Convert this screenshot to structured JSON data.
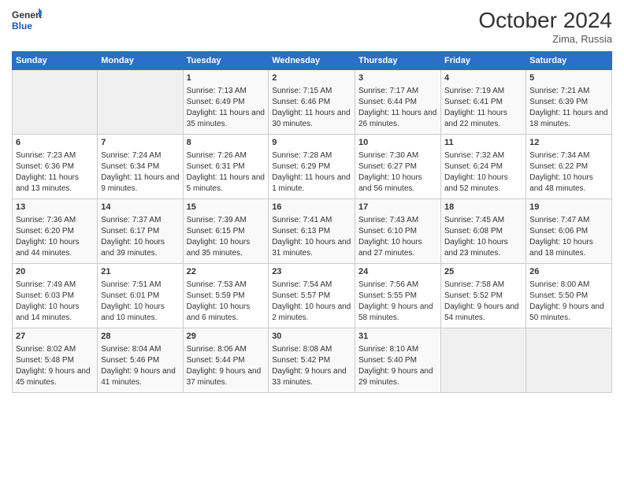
{
  "header": {
    "logo_line1": "General",
    "logo_line2": "Blue",
    "month": "October 2024",
    "location": "Zima, Russia"
  },
  "days_of_week": [
    "Sunday",
    "Monday",
    "Tuesday",
    "Wednesday",
    "Thursday",
    "Friday",
    "Saturday"
  ],
  "weeks": [
    [
      {
        "day": "",
        "sunrise": "",
        "sunset": "",
        "daylight": ""
      },
      {
        "day": "",
        "sunrise": "",
        "sunset": "",
        "daylight": ""
      },
      {
        "day": "1",
        "sunrise": "Sunrise: 7:13 AM",
        "sunset": "Sunset: 6:49 PM",
        "daylight": "Daylight: 11 hours and 35 minutes."
      },
      {
        "day": "2",
        "sunrise": "Sunrise: 7:15 AM",
        "sunset": "Sunset: 6:46 PM",
        "daylight": "Daylight: 11 hours and 30 minutes."
      },
      {
        "day": "3",
        "sunrise": "Sunrise: 7:17 AM",
        "sunset": "Sunset: 6:44 PM",
        "daylight": "Daylight: 11 hours and 26 minutes."
      },
      {
        "day": "4",
        "sunrise": "Sunrise: 7:19 AM",
        "sunset": "Sunset: 6:41 PM",
        "daylight": "Daylight: 11 hours and 22 minutes."
      },
      {
        "day": "5",
        "sunrise": "Sunrise: 7:21 AM",
        "sunset": "Sunset: 6:39 PM",
        "daylight": "Daylight: 11 hours and 18 minutes."
      }
    ],
    [
      {
        "day": "6",
        "sunrise": "Sunrise: 7:23 AM",
        "sunset": "Sunset: 6:36 PM",
        "daylight": "Daylight: 11 hours and 13 minutes."
      },
      {
        "day": "7",
        "sunrise": "Sunrise: 7:24 AM",
        "sunset": "Sunset: 6:34 PM",
        "daylight": "Daylight: 11 hours and 9 minutes."
      },
      {
        "day": "8",
        "sunrise": "Sunrise: 7:26 AM",
        "sunset": "Sunset: 6:31 PM",
        "daylight": "Daylight: 11 hours and 5 minutes."
      },
      {
        "day": "9",
        "sunrise": "Sunrise: 7:28 AM",
        "sunset": "Sunset: 6:29 PM",
        "daylight": "Daylight: 11 hours and 1 minute."
      },
      {
        "day": "10",
        "sunrise": "Sunrise: 7:30 AM",
        "sunset": "Sunset: 6:27 PM",
        "daylight": "Daylight: 10 hours and 56 minutes."
      },
      {
        "day": "11",
        "sunrise": "Sunrise: 7:32 AM",
        "sunset": "Sunset: 6:24 PM",
        "daylight": "Daylight: 10 hours and 52 minutes."
      },
      {
        "day": "12",
        "sunrise": "Sunrise: 7:34 AM",
        "sunset": "Sunset: 6:22 PM",
        "daylight": "Daylight: 10 hours and 48 minutes."
      }
    ],
    [
      {
        "day": "13",
        "sunrise": "Sunrise: 7:36 AM",
        "sunset": "Sunset: 6:20 PM",
        "daylight": "Daylight: 10 hours and 44 minutes."
      },
      {
        "day": "14",
        "sunrise": "Sunrise: 7:37 AM",
        "sunset": "Sunset: 6:17 PM",
        "daylight": "Daylight: 10 hours and 39 minutes."
      },
      {
        "day": "15",
        "sunrise": "Sunrise: 7:39 AM",
        "sunset": "Sunset: 6:15 PM",
        "daylight": "Daylight: 10 hours and 35 minutes."
      },
      {
        "day": "16",
        "sunrise": "Sunrise: 7:41 AM",
        "sunset": "Sunset: 6:13 PM",
        "daylight": "Daylight: 10 hours and 31 minutes."
      },
      {
        "day": "17",
        "sunrise": "Sunrise: 7:43 AM",
        "sunset": "Sunset: 6:10 PM",
        "daylight": "Daylight: 10 hours and 27 minutes."
      },
      {
        "day": "18",
        "sunrise": "Sunrise: 7:45 AM",
        "sunset": "Sunset: 6:08 PM",
        "daylight": "Daylight: 10 hours and 23 minutes."
      },
      {
        "day": "19",
        "sunrise": "Sunrise: 7:47 AM",
        "sunset": "Sunset: 6:06 PM",
        "daylight": "Daylight: 10 hours and 18 minutes."
      }
    ],
    [
      {
        "day": "20",
        "sunrise": "Sunrise: 7:49 AM",
        "sunset": "Sunset: 6:03 PM",
        "daylight": "Daylight: 10 hours and 14 minutes."
      },
      {
        "day": "21",
        "sunrise": "Sunrise: 7:51 AM",
        "sunset": "Sunset: 6:01 PM",
        "daylight": "Daylight: 10 hours and 10 minutes."
      },
      {
        "day": "22",
        "sunrise": "Sunrise: 7:53 AM",
        "sunset": "Sunset: 5:59 PM",
        "daylight": "Daylight: 10 hours and 6 minutes."
      },
      {
        "day": "23",
        "sunrise": "Sunrise: 7:54 AM",
        "sunset": "Sunset: 5:57 PM",
        "daylight": "Daylight: 10 hours and 2 minutes."
      },
      {
        "day": "24",
        "sunrise": "Sunrise: 7:56 AM",
        "sunset": "Sunset: 5:55 PM",
        "daylight": "Daylight: 9 hours and 58 minutes."
      },
      {
        "day": "25",
        "sunrise": "Sunrise: 7:58 AM",
        "sunset": "Sunset: 5:52 PM",
        "daylight": "Daylight: 9 hours and 54 minutes."
      },
      {
        "day": "26",
        "sunrise": "Sunrise: 8:00 AM",
        "sunset": "Sunset: 5:50 PM",
        "daylight": "Daylight: 9 hours and 50 minutes."
      }
    ],
    [
      {
        "day": "27",
        "sunrise": "Sunrise: 8:02 AM",
        "sunset": "Sunset: 5:48 PM",
        "daylight": "Daylight: 9 hours and 45 minutes."
      },
      {
        "day": "28",
        "sunrise": "Sunrise: 8:04 AM",
        "sunset": "Sunset: 5:46 PM",
        "daylight": "Daylight: 9 hours and 41 minutes."
      },
      {
        "day": "29",
        "sunrise": "Sunrise: 8:06 AM",
        "sunset": "Sunset: 5:44 PM",
        "daylight": "Daylight: 9 hours and 37 minutes."
      },
      {
        "day": "30",
        "sunrise": "Sunrise: 8:08 AM",
        "sunset": "Sunset: 5:42 PM",
        "daylight": "Daylight: 9 hours and 33 minutes."
      },
      {
        "day": "31",
        "sunrise": "Sunrise: 8:10 AM",
        "sunset": "Sunset: 5:40 PM",
        "daylight": "Daylight: 9 hours and 29 minutes."
      },
      {
        "day": "",
        "sunrise": "",
        "sunset": "",
        "daylight": ""
      },
      {
        "day": "",
        "sunrise": "",
        "sunset": "",
        "daylight": ""
      }
    ]
  ]
}
